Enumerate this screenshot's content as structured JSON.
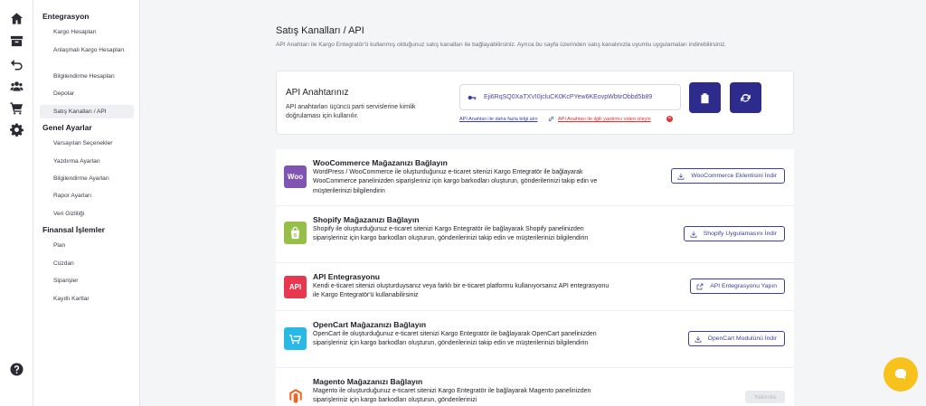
{
  "rail": {
    "icons": [
      "home-icon",
      "archive-icon",
      "return-icon",
      "users-icon",
      "cart-icon",
      "gear-icon",
      "help-icon"
    ]
  },
  "sidebar": {
    "sections": [
      {
        "title": "Entegrasyon",
        "items": [
          "Kargo Hesapları",
          "Anlaşmalı Kargo Hesapları",
          "Bilgilendirme Hesapları",
          "Depolar",
          "Satış Kanalları / API"
        ]
      },
      {
        "title": "Genel Ayarlar",
        "items": [
          "Varsayılan Seçenekler",
          "Yazdırma Ayarları",
          "Bilgilendirme Ayarları",
          "Rapor Ayarları",
          "Veri Gizliliği"
        ]
      },
      {
        "title": "Finansal İşlemler",
        "items": [
          "Plan",
          "Cüzdan",
          "Siparişler",
          "Kayıtlı Kartlar"
        ]
      }
    ]
  },
  "page": {
    "title": "Satış Kanalları / API",
    "description": "API Anahtarı ile Kargo Entegratör'ü kullanmış olduğunuz satış kanalları ile bağlayabilirsiniz. Ayrıca bu sayfa üzerinden satış kanalınızla uyumlu uygulamaları indirebilirsiniz."
  },
  "api": {
    "title": "API Anahtarınız",
    "description": "API anahtarları üçüncü parti servislerine kimlik doğrulaması için kullanılır.",
    "key_value": "Eji6RqSQ0XaTXVI0jcluCK0KcPYew6KEovpWbtirObbd5b89",
    "link_info": "API Anahtarı ile daha fazla bilgi alın",
    "link_video": "API Anahtarı ile ilgili yardımcı video izleyin"
  },
  "integrations": [
    {
      "logo_text": "Woo",
      "logo_color": "#7f54b3",
      "title": "WooCommerce Mağazanızı Bağlayın",
      "description": "WordPress / WooCommerce ile oluşturduğunuz e-ticaret sitenizi Kargo Entegratör ile bağlayarak WooCommerce panelinizden siparişleriniz için kargo barkodları oluşturun, gönderilerinizi takip edin ve müşterilerinizi bilgilendirin",
      "button": "WooCommerce Eklentisini İndir",
      "button_icon": "download-icon"
    },
    {
      "logo_text": "S",
      "logo_color": "#95bf47",
      "title": "Shopify Mağazanızı Bağlayın",
      "description": "Shopify ile oluşturduğunuz e-ticaret sitenizi Kargo Entegratör ile bağlayarak Shopify panelinizden siparişleriniz için kargo barkodları oluşturun, gönderilerinizi takip edin ve müşterilerinizi bilgilendirin",
      "button": "Shopify Uygulamasını İndir",
      "button_icon": "download-icon"
    },
    {
      "logo_text": "API",
      "logo_color": "#e8384f",
      "title": "API Entegrasyonu",
      "description": "Kendi e-ticaret sitenizi oluşturduysanız veya farklı bir e-ticaret platformu kullanıyorsanız API entegrasyonu ile Kargo Entegratör'ü kullanabilirsiniz",
      "button": "API Entegrasyonu Yapın",
      "button_icon": "external-link-icon"
    },
    {
      "logo_text": "",
      "logo_color": "#29b9e6",
      "title": "OpenCart Mağazanızı Bağlayın",
      "description": "OpenCart ile oluşturduğunuz e-ticaret sitenizi Kargo Entegratör ile bağlayarak OpenCart panelinizden siparişleriniz için kargo barkodları oluşturun, gönderilerinizi takip edin ve müşterilerinizi bilgilendirin",
      "button": "OpenCart Modulünü İndir",
      "button_icon": "download-icon"
    },
    {
      "logo_text": "M",
      "logo_color": "#f26322",
      "title": "Magento Mağazanızı Bağlayın",
      "description": "Magento ile oluşturduğunuz e-ticaret sitenizi Kargo Entegratör ile bağlayarak Magento panelinizden siparişleriniz için kargo barkodları oluşturun, gönderilerinizi",
      "button": "Yakında",
      "button_icon": ""
    }
  ],
  "colors": {
    "accent": "#2d2b8c",
    "chat": "#f6c21b"
  }
}
